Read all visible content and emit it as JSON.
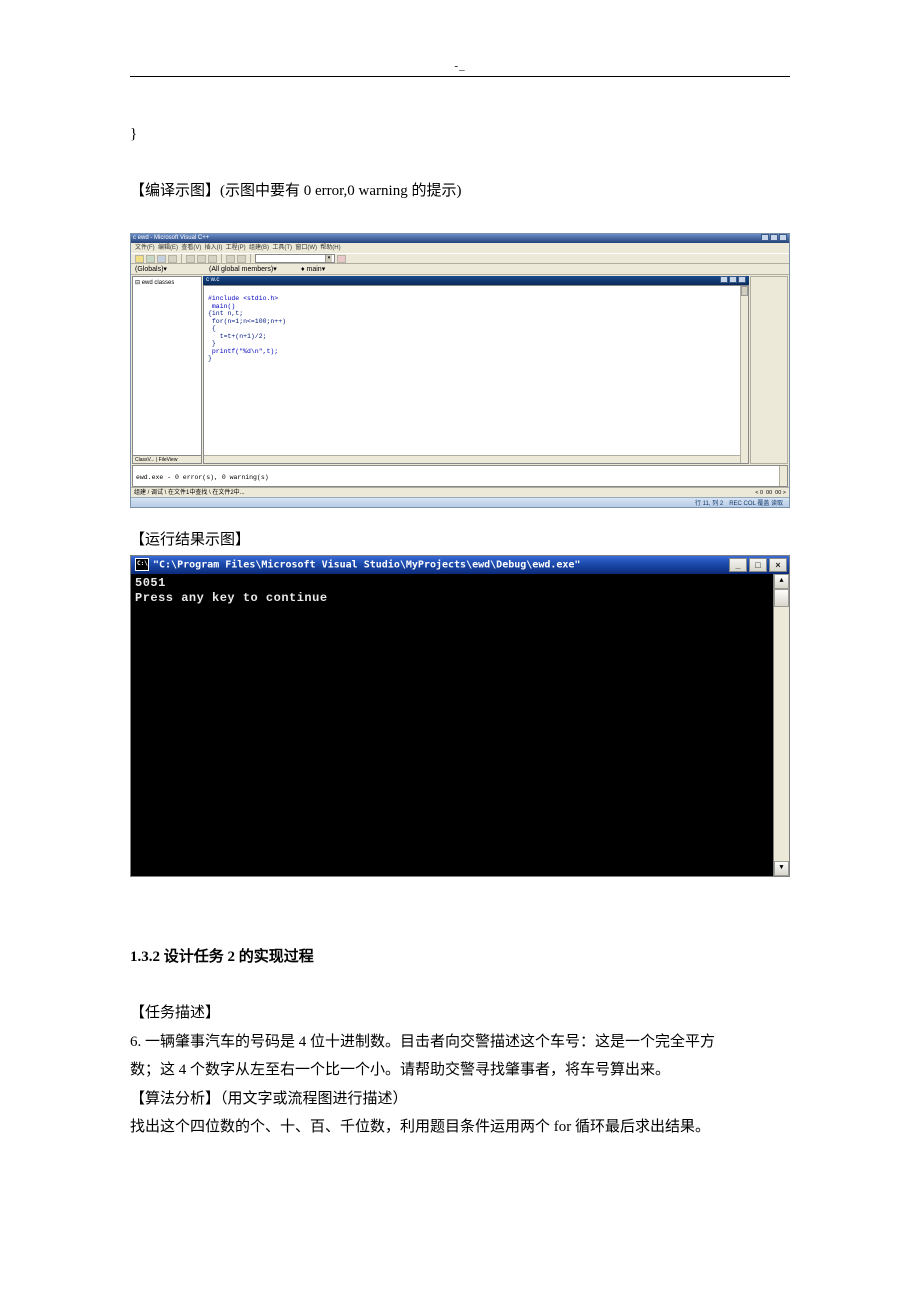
{
  "header_dash": "-_",
  "brace": "}",
  "heading_compile": "【编译示图】(示图中要有 0 error,0 warning 的提示)",
  "ide": {
    "title": "c ewd - Microsoft Visual C++",
    "menubar": "文件(F)  编辑(E)  查看(V)  插入(I)  工程(P)  组建(B)  工具(T)  窗口(W)  帮助(H)",
    "combo_globals": "(Globals)",
    "combo_members": "(All global members)",
    "combo_main": "♦ main",
    "tree_root": "⊟ ewd classes",
    "tree_tabs": "ClassV... | FileView",
    "editor_tab": "c w.c",
    "code_lines": [
      "#include <stdio.h>",
      " main()",
      "{int n,t;",
      " for(n=1;n<=100;n++)",
      " {",
      "   t=t+(n+1)/2;",
      " }",
      " printf(\"%d\\n\",t);",
      "}"
    ],
    "output_line": "ewd.exe - 0 error(s), 0 warning(s)",
    "output_tabs": "组建 / 调试 \\ 在文件1中查找 \\ 在文件2中...",
    "find_labels": [
      "< 0",
      "00",
      "00 >"
    ],
    "status_line": "行 11, 列 2",
    "status_mode": "REC COL 覆盖 读取"
  },
  "heading_run": "【运行结果示图】",
  "console": {
    "title": "\"C:\\Program Files\\Microsoft Visual Studio\\MyProjects\\ewd\\Debug\\ewd.exe\"",
    "lines": [
      "5051",
      "Press any key to continue"
    ],
    "min": "_",
    "max": "□",
    "close": "×",
    "up": "▲",
    "down": "▼"
  },
  "section_no": "1.3.2 设计任务 2 的实现过程",
  "task_label": "【任务描述】",
  "task_line1": "6.  一辆肇事汽车的号码是 4 位十进制数。目击者向交警描述这个车号：这是一个完全平方",
  "task_line2": "数；这 4 个数字从左至右一个比一个小。请帮助交警寻找肇事者，将车号算出来。",
  "algo_label": "【算法分析】（用文字或流程图进行描述）",
  "algo_line": "找出这个四位数的个、十、百、千位数，利用题目条件运用两个 for 循环最后求出结果。"
}
